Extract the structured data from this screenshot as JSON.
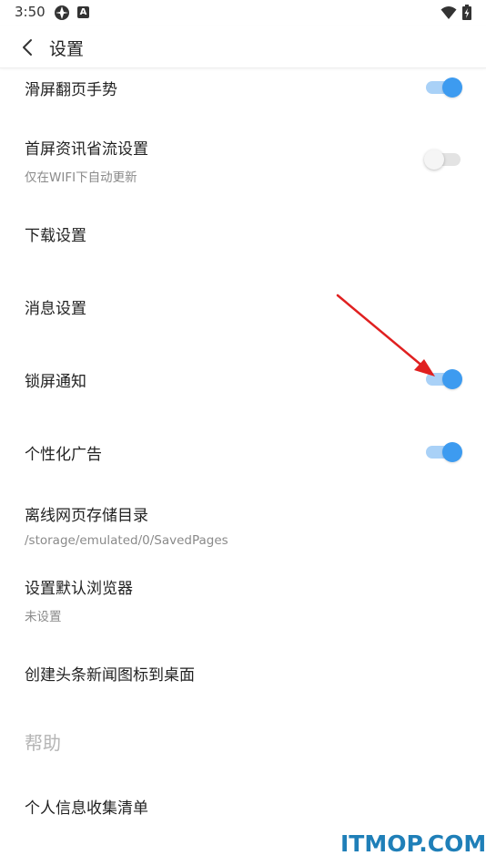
{
  "status_bar": {
    "time": "3:50",
    "icons": [
      "app-icon",
      "a-icon",
      "wifi-icon",
      "battery-icon"
    ],
    "a_label": "A"
  },
  "header": {
    "title": "设置",
    "back_icon": "chevron-left-icon"
  },
  "settings": {
    "swipe_gesture": {
      "label": "滑屏翻页手势",
      "toggle": true
    },
    "data_saving": {
      "label": "首屏资讯省流设置",
      "sublabel": "仅在WIFI下自动更新",
      "toggle": false
    },
    "download": {
      "label": "下载设置"
    },
    "message": {
      "label": "消息设置"
    },
    "lockscreen_notify": {
      "label": "锁屏通知",
      "toggle": true
    },
    "personalized_ads": {
      "label": "个性化广告",
      "toggle": true
    },
    "offline_dir": {
      "label": "离线网页存储目录",
      "sublabel": "/storage/emulated/0/SavedPages"
    },
    "default_browser": {
      "label": "设置默认浏览器",
      "sublabel": "未设置"
    },
    "desktop_shortcut": {
      "label": "创建头条新闻图标到桌面"
    },
    "help_section": {
      "label": "帮助"
    },
    "personal_info": {
      "label": "个人信息收集清单"
    }
  },
  "colors": {
    "accent": "#3d9bf0",
    "accent_track": "#a9d1f7",
    "annotation_arrow": "#e02020",
    "watermark": "#1f7fb8"
  },
  "watermark": {
    "text": "ITMOP.COM"
  }
}
